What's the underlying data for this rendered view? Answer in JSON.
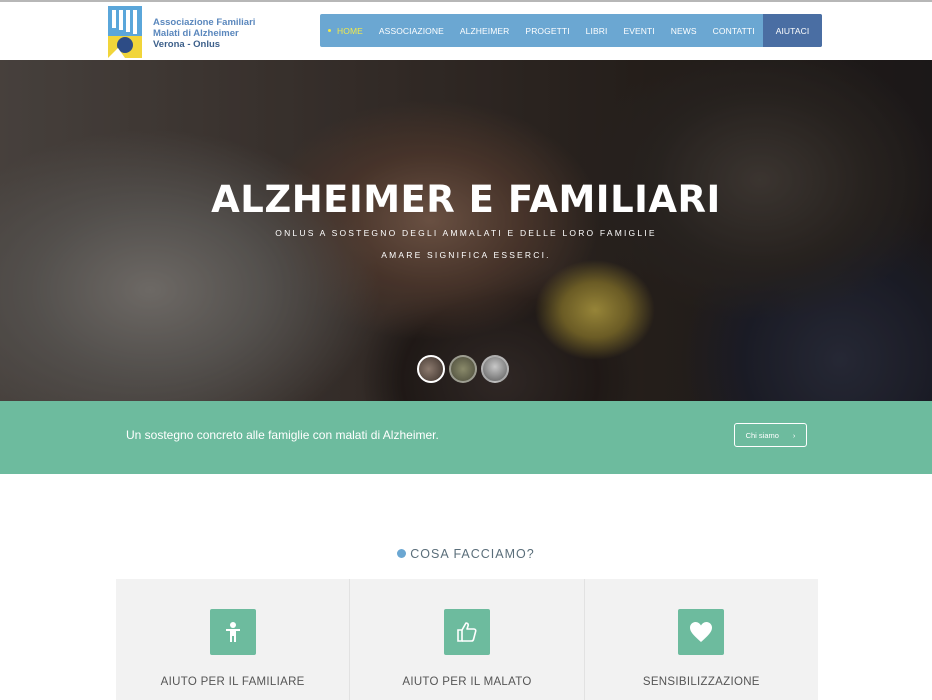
{
  "logo": {
    "line1": "Associazione Familiari",
    "line2": "Malati di Alzheimer",
    "line3": "Verona - Onlus",
    "icon": "association-logo-icon"
  },
  "nav": {
    "items": [
      {
        "label": "HOME",
        "active": true
      },
      {
        "label": "ASSOCIAZIONE"
      },
      {
        "label": "ALZHEIMER"
      },
      {
        "label": "PROGETTI"
      },
      {
        "label": "LIBRI"
      },
      {
        "label": "EVENTI"
      },
      {
        "label": "NEWS"
      },
      {
        "label": "CONTATTI"
      },
      {
        "label": "AIUTACI"
      }
    ]
  },
  "hero": {
    "title": "ALZHEIMER E FAMILIARI",
    "subtitle": "ONLUS A SOSTEGNO DEGLI AMMALATI E DELLE LORO FAMIGLIE",
    "tagline": "AMARE SIGNIFICA ESSERCI."
  },
  "band": {
    "text": "Un sostegno concreto alle famiglie con malati di Alzheimer.",
    "button_label": "Chi siamo",
    "button_icon": "chevron-right-icon"
  },
  "section": {
    "title": "COSA FACCIAMO?"
  },
  "cards": [
    {
      "title": "AIUTO PER IL FAMILIARE",
      "icon": "person-icon"
    },
    {
      "title": "AIUTO PER IL MALATO",
      "icon": "thumbs-up-icon"
    },
    {
      "title": "SENSIBILIZZAZIONE",
      "icon": "heart-icon"
    }
  ],
  "colors": {
    "nav": "#6ba7d2",
    "nav_accent": "#4a6ea3",
    "green": "#6dbb9e",
    "active": "#f2e94a"
  }
}
